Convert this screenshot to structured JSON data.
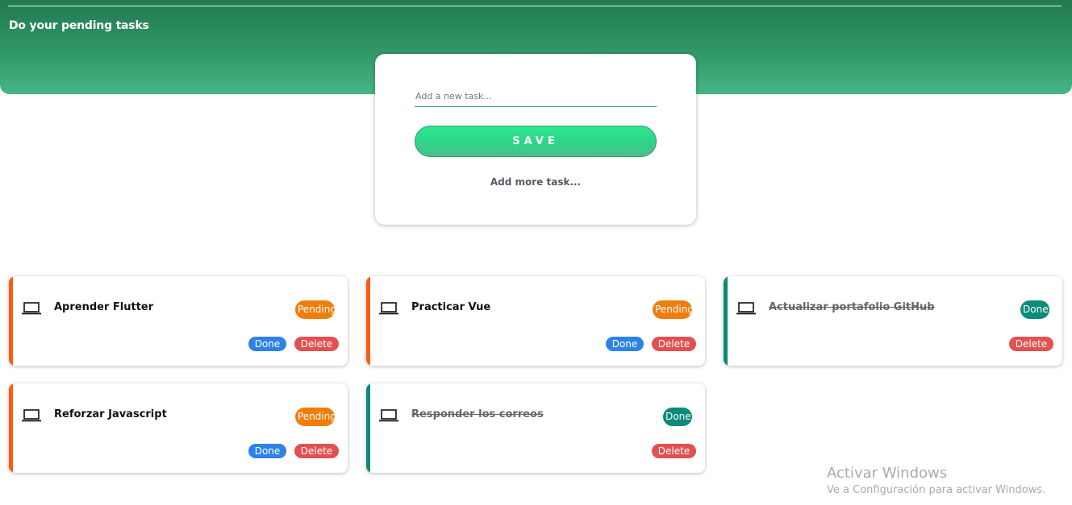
{
  "header": {
    "title": "Do your pending tasks"
  },
  "form": {
    "input_placeholder": "Add a new task...",
    "input_value": "",
    "save_label": "SAVE",
    "add_more_label": "Add more task..."
  },
  "tasks": [
    {
      "name": "Aprender Flutter",
      "status": "Pending",
      "done_label": "Done",
      "delete_label": "Delete"
    },
    {
      "name": "Practicar Vue",
      "status": "Pending",
      "done_label": "Done",
      "delete_label": "Delete"
    },
    {
      "name": "Actualizar portafolio GitHub",
      "status": "Done",
      "delete_label": "Delete"
    },
    {
      "name": "Reforzar Javascript",
      "status": "Pending",
      "done_label": "Done",
      "delete_label": "Delete"
    },
    {
      "name": "Responder los correos",
      "status": "Done",
      "delete_label": "Delete"
    }
  ],
  "watermark": {
    "line1": "Activar Windows",
    "line2": "Ve a Configuración para activar Windows."
  },
  "colors": {
    "header_gradient_top": "#237a50",
    "header_gradient_bottom": "#46b686",
    "pending_accent": "#ff5a10",
    "pending_badge": "#ef7d0c",
    "done_accent": "#0c8a7a",
    "done_button": "#2d83e4",
    "delete_button": "#e0514f",
    "save_button": "#2fe892"
  },
  "icons": {
    "task_icon": "laptop-icon"
  }
}
